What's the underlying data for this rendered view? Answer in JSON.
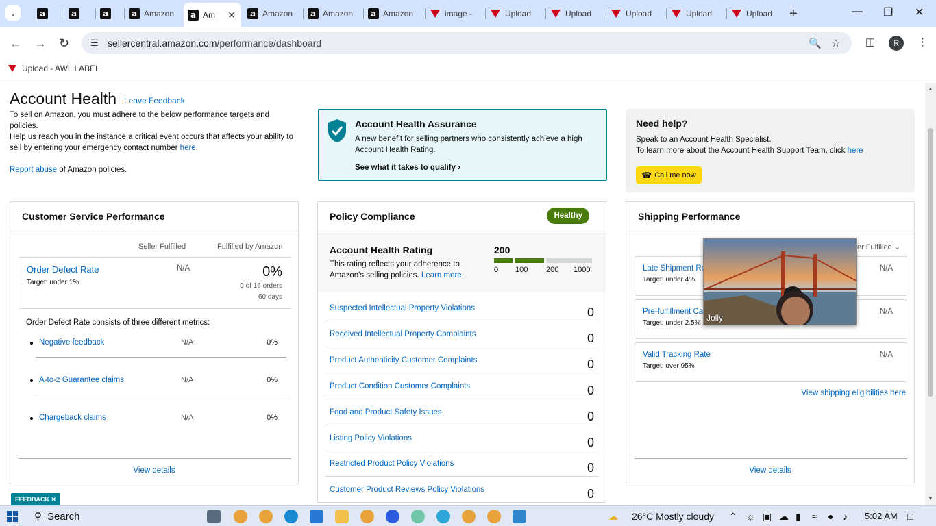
{
  "browser": {
    "tabs": [
      {
        "title": "",
        "type": "amazon"
      },
      {
        "title": "",
        "type": "amazon"
      },
      {
        "title": "",
        "type": "amazon"
      },
      {
        "title": "Amazon",
        "type": "amazon"
      },
      {
        "title": "Am",
        "type": "amazon",
        "active": true
      },
      {
        "title": "Amazon",
        "type": "amazon"
      },
      {
        "title": "Amazon",
        "type": "amazon"
      },
      {
        "title": "Amazon",
        "type": "amazon"
      },
      {
        "title": "image -",
        "type": "awl"
      },
      {
        "title": "Upload",
        "type": "awl"
      },
      {
        "title": "Upload",
        "type": "awl"
      },
      {
        "title": "Upload",
        "type": "awl"
      },
      {
        "title": "Upload",
        "type": "awl"
      },
      {
        "title": "Upload",
        "type": "awl"
      }
    ],
    "url_domain": "sellercentral.amazon.com",
    "url_path": "/performance/dashboard",
    "profile_initial": "R",
    "bookmark": "Upload - AWL LABEL"
  },
  "page": {
    "title": "Account Health",
    "leave_feedback": "Leave Feedback",
    "desc_1": "To sell on Amazon, you must adhere to the below performance targets and policies.",
    "desc_2": "Help us reach you in the instance a critical event occurs that affects your ability to sell by entering your emergency contact number",
    "desc_2_link": "here",
    "report_abuse_link": "Report abuse",
    "report_abuse_text": "of Amazon policies.",
    "assurance": {
      "title": "Account Health Assurance",
      "text": "A new benefit for selling partners who consistently achieve a high Account Health Rating.",
      "cta": "See what it takes to qualify"
    },
    "help": {
      "title": "Need help?",
      "line1": "Speak to an Account Health Specialist.",
      "line2": "To learn more about the Account Health Support Team, click",
      "line2_link": "here",
      "call_button": "Call me now"
    }
  },
  "customer_service": {
    "title": "Customer Service Performance",
    "col_seller": "Seller Fulfilled",
    "col_amazon": "Fulfilled by Amazon",
    "odr_name": "Order Defect Rate",
    "odr_target_label": "Target",
    "odr_target": ": under 1%",
    "odr_seller": "N/A",
    "odr_amazon": "0%",
    "odr_orders": "0 of 16 orders",
    "odr_days": "60 days",
    "metrics_intro": "Order Defect Rate consists of three different metrics:",
    "metrics": [
      {
        "name": "Negative feedback",
        "seller": "N/A",
        "amazon": "0%"
      },
      {
        "name": "A-to-z Guarantee claims",
        "seller": "N/A",
        "amazon": "0%"
      },
      {
        "name": "Chargeback claims",
        "seller": "N/A",
        "amazon": "0%"
      }
    ],
    "view_details": "View details"
  },
  "policy": {
    "title": "Policy Compliance",
    "status": "Healthy",
    "rating_title": "Account Health Rating",
    "rating_text": "This rating reflects your adherence to Amazon's selling policies.",
    "rating_link": "Learn more.",
    "rating_value": "200",
    "scale_labels": [
      "0",
      "100",
      "200",
      "1000"
    ],
    "rows": [
      {
        "name": "Suspected Intellectual Property Violations",
        "value": "0"
      },
      {
        "name": "Received Intellectual Property Complaints",
        "value": "0"
      },
      {
        "name": "Product Authenticity Customer Complaints",
        "value": "0"
      },
      {
        "name": "Product Condition Customer Complaints",
        "value": "0"
      },
      {
        "name": "Food and Product Safety Issues",
        "value": "0"
      },
      {
        "name": "Listing Policy Violations",
        "value": "0"
      },
      {
        "name": "Restricted Product Policy Violations",
        "value": "0"
      },
      {
        "name": "Customer Product Reviews Policy Violations",
        "value": "0"
      }
    ]
  },
  "shipping": {
    "title": "Shipping Performance",
    "dropdown": "er Fulfilled",
    "rows": [
      {
        "name": "Late Shipment Ra",
        "target_label": "Target",
        "target": ": under 4%",
        "value": "N/A"
      },
      {
        "name": "Pre-fulfillment Ca",
        "target_label": "Target",
        "target": ": under 2.5%",
        "value": "N/A"
      },
      {
        "name": "Valid Tracking Rate",
        "target_label": "Target",
        "target": ": over 95%",
        "value": "N/A"
      }
    ],
    "eligibilities": "View shipping eligibilities here",
    "view_details": "View details"
  },
  "video_overlay": {
    "name": "Jolly"
  },
  "feedback_tab": "FEEDBACK",
  "taskbar": {
    "search": "Search",
    "weather": "26°C  Mostly cloudy",
    "time": "5:02 AM"
  },
  "colors": {
    "link": "#0066c0",
    "healthy": "#487b0a",
    "call_button": "#ffd814",
    "assurance_bg": "#e6f6f9",
    "tab_strip": "#d3e3fd"
  }
}
